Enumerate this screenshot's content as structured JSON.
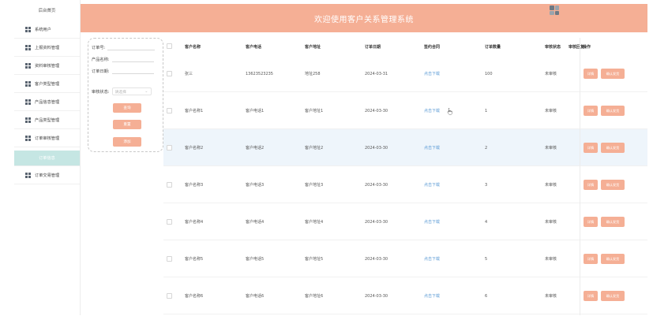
{
  "sidebar": {
    "home": "后台首页",
    "items": [
      {
        "label": "系统用户"
      },
      {
        "label": "上报资料管理"
      },
      {
        "label": "资料审核管理"
      },
      {
        "label": "客户类型管理"
      },
      {
        "label": "产品信息管理"
      },
      {
        "label": "产品类型管理"
      },
      {
        "label": "订单审核管理"
      },
      {
        "label": "订单信息"
      },
      {
        "label": "订单交易管理"
      }
    ]
  },
  "header": {
    "title": "欢迎使用客户关系管理系统"
  },
  "search": {
    "order_no_label": "订单号:",
    "product_name_label": "产品名称:",
    "order_date_label": "订单日期:",
    "review_status_label": "审核状态:",
    "review_status_placeholder": "请选择",
    "query_button": "查询",
    "reset_button": "重置",
    "add_button": "添加"
  },
  "table": {
    "headers": [
      "客户名称",
      "客户电话",
      "客户地址",
      "订单日期",
      "签约合同",
      "订单数量",
      "审核状态",
      "审核回复",
      "操作"
    ],
    "rows": [
      {
        "name": "张三",
        "phone": "13623523235",
        "address": "地址258",
        "date": "2024-03-31",
        "contract": "点击下载",
        "quantity": "100",
        "status": "未审核"
      },
      {
        "name": "客户名称1",
        "phone": "客户电话1",
        "address": "客户地址1",
        "date": "2024-03-30",
        "contract": "点击下载",
        "quantity": "1",
        "status": "未审核"
      },
      {
        "name": "客户名称2",
        "phone": "客户电话2",
        "address": "客户地址2",
        "date": "2024-03-30",
        "contract": "点击下载",
        "quantity": "2",
        "status": "未审核"
      },
      {
        "name": "客户名称3",
        "phone": "客户电话3",
        "address": "客户地址3",
        "date": "2024-03-30",
        "contract": "点击下载",
        "quantity": "3",
        "status": "未审核"
      },
      {
        "name": "客户名称4",
        "phone": "客户电话4",
        "address": "客户地址4",
        "date": "2024-03-30",
        "contract": "点击下载",
        "quantity": "4",
        "status": "未审核"
      },
      {
        "name": "客户名称5",
        "phone": "客户电话5",
        "address": "客户地址5",
        "date": "2024-03-30",
        "contract": "点击下载",
        "quantity": "5",
        "status": "未审核"
      },
      {
        "name": "客户名称6",
        "phone": "客户电话6",
        "address": "客户地址6",
        "date": "2024-03-30",
        "contract": "点击下载",
        "quantity": "6",
        "status": "未审核"
      }
    ],
    "detail_button": "详情",
    "confirm_button": "确认发货"
  },
  "colors": {
    "accent": "#f5af95",
    "active_nav": "#c5e6e3",
    "link": "#5b9bd5",
    "highlight_row": "#eef5fb"
  }
}
